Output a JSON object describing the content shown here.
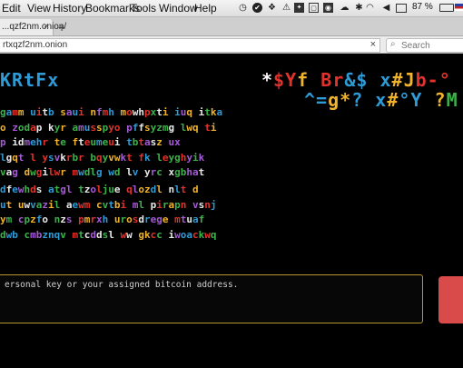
{
  "menubar": {
    "items": [
      "Edit",
      "View",
      "History",
      "Bookmarks",
      "Tools",
      "Window",
      "Help"
    ],
    "battery": "87 %"
  },
  "tab": {
    "title": "...qzf2nm.onion/",
    "close": "×",
    "new_tab": "+"
  },
  "url_bar": {
    "value": "rtxqzf2nm.onion",
    "clear": "×"
  },
  "search_bar": {
    "placeholder": "Search"
  },
  "big_text": [
    {
      "text": "KRtFx",
      "color": "#2e9bd6"
    },
    {
      "text": "*$Yf Br&$ x#Jb-°",
      "colors": [
        "#ffffff",
        "#e3322b",
        "#e3322b",
        "#f0b32b",
        "#2e9bd6",
        "#e3322b",
        "#e3322b",
        "#2e9bd6",
        "#2e9bd6",
        "#e3322b",
        "#2e9bd6",
        "#f0b32b",
        "#f0b32b",
        "#e3322b",
        "#e3322b",
        "#e3322b"
      ]
    },
    {
      "text": "^=g*? x#°Y ?M",
      "colors": [
        "#2e9bd6",
        "#2e9bd6",
        "#f0b32b",
        "#f0b32b",
        "#2e9bd6",
        "#ffffff",
        "#2e9bd6",
        "#f0b32b",
        "#2e9bd6",
        "#2e9bd6",
        "#ffffff",
        "#f0b32b",
        "#3bb34a"
      ]
    }
  ],
  "paragraph1": [
    "gamm uitb saui nfmh mowhpxti iuq itka",
    "o zodap kyr amusspyo pffsyzmg lwq ti",
    "p  idmehr  te  fteumeui  tbtasz  ux",
    "lgqt l ysvkrbr bqyvwkt fk leyghyik",
    "vag dwgilwr mwdlg wd lv yrc xgbhat"
  ],
  "paragraph2": [
    "dfewhds atgl tzoljue qlozdl nlt d",
    "ut uwvazil aewm cvtbi ml pirapn vsnj",
    "ym cpzfo nzs pmrxh urosdrege mtuaf",
    "dwb cmbznqv mtcddsl ww gkcc iwoackwq"
  ],
  "text_colors": [
    "#e3322b",
    "#f0b32b",
    "#3bb34a",
    "#2e9bd6",
    "#a45bd6",
    "#e8e8e8"
  ],
  "input": {
    "placeholder": "ersonal key or your assigned bitcoin address."
  }
}
